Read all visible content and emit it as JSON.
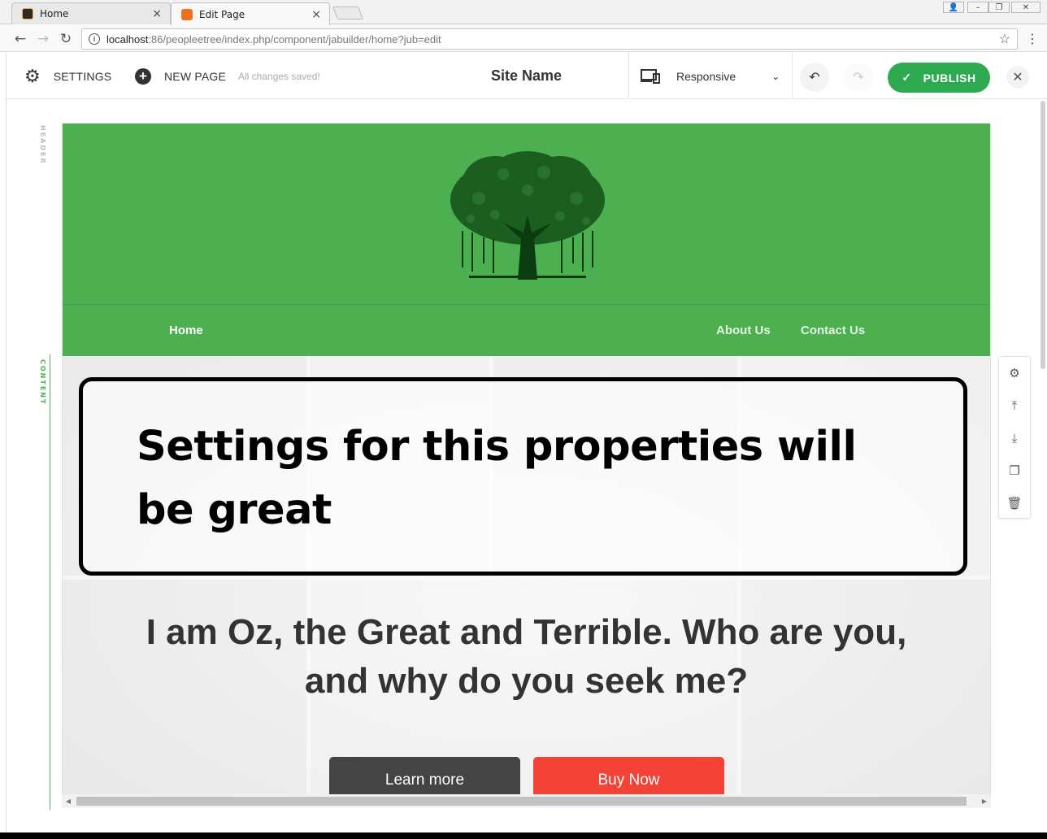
{
  "browser": {
    "tabs": [
      {
        "title": "Home",
        "active": false
      },
      {
        "title": "Edit Page",
        "active": true
      }
    ],
    "url_host": "localhost",
    "url_path": ":86/peopleetree/index.php/component/jabuilder/home?jub=edit"
  },
  "app": {
    "settings_label": "SETTINGS",
    "new_page_label": "NEW PAGE",
    "save_status": "All changes saved!",
    "site_name": "Site Name",
    "device_mode": "Responsive",
    "publish_label": "PUBLISH"
  },
  "sections": {
    "header_label": "HEADER",
    "content_label": "CONTENT"
  },
  "nav": {
    "home": "Home",
    "about": "About Us",
    "contact": "Contact Us"
  },
  "hero": {
    "heading": "I am Oz, the Great and Terrible. Who are you, and why do you seek me?",
    "learn_more": "Learn more",
    "buy_now": "Buy Now"
  },
  "annotation": {
    "text": "Settings for this properties will be great"
  },
  "colors": {
    "header_green": "#4caf50",
    "publish_green": "#2da94f",
    "buy_red": "#f44336",
    "learn_dark": "#444444"
  },
  "icons": [
    "gear-icon",
    "plus-circle-icon",
    "device-icon",
    "chevron-down-icon",
    "undo-icon",
    "redo-icon",
    "check-icon",
    "close-icon",
    "move-top-icon",
    "move-bottom-icon",
    "duplicate-icon",
    "trash-icon",
    "tree-logo"
  ]
}
